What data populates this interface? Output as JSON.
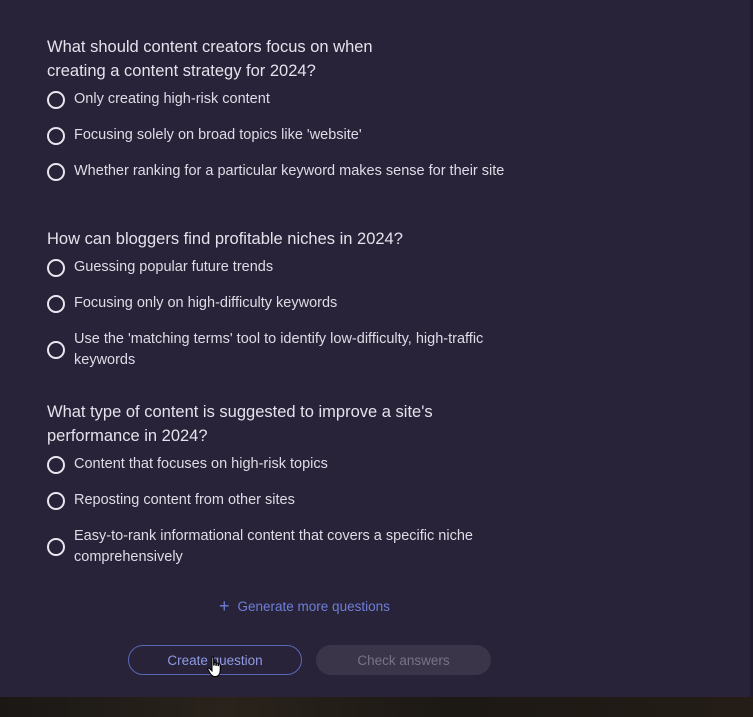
{
  "questions": [
    {
      "title_line1": "What should content creators focus on when",
      "title_line2": "creating a content strategy for 2024?",
      "options": [
        {
          "label": "Only creating high-risk content",
          "selected": false
        },
        {
          "label": "Focusing solely on broad topics like 'website'",
          "selected": false
        },
        {
          "label": "Whether ranking for a particular keyword makes sense for their site",
          "selected": false
        }
      ]
    },
    {
      "title_line1": "How can bloggers find profitable niches in 2024?",
      "title_line2": "",
      "options": [
        {
          "label": "Guessing popular future trends",
          "selected": false
        },
        {
          "label": "Focusing only on high-difficulty keywords",
          "selected": false
        },
        {
          "label_line1": "Use the 'matching terms' tool to identify low-difficulty, high-traffic",
          "label_line2": "keywords",
          "selected": false
        }
      ]
    },
    {
      "title_line1": "What type of content is suggested to improve a site's",
      "title_line2": "performance in 2024?",
      "options": [
        {
          "label": "Content that focuses on high-risk topics",
          "selected": false
        },
        {
          "label": "Reposting content from other sites",
          "selected": false
        },
        {
          "label_line1": "Easy-to-rank informational content that covers a specific niche",
          "label_line2": "comprehensively",
          "selected": false
        }
      ]
    }
  ],
  "actions": {
    "generate_more_icon": "plus-icon",
    "generate_more_label": "Generate more questions",
    "create_question_label": "Create question",
    "check_answers_label": "Check answers"
  },
  "colors": {
    "background": "#282338",
    "accent": "#6f7fd8",
    "text": "#e4e2ec",
    "disabled_button": "#3a3548"
  }
}
